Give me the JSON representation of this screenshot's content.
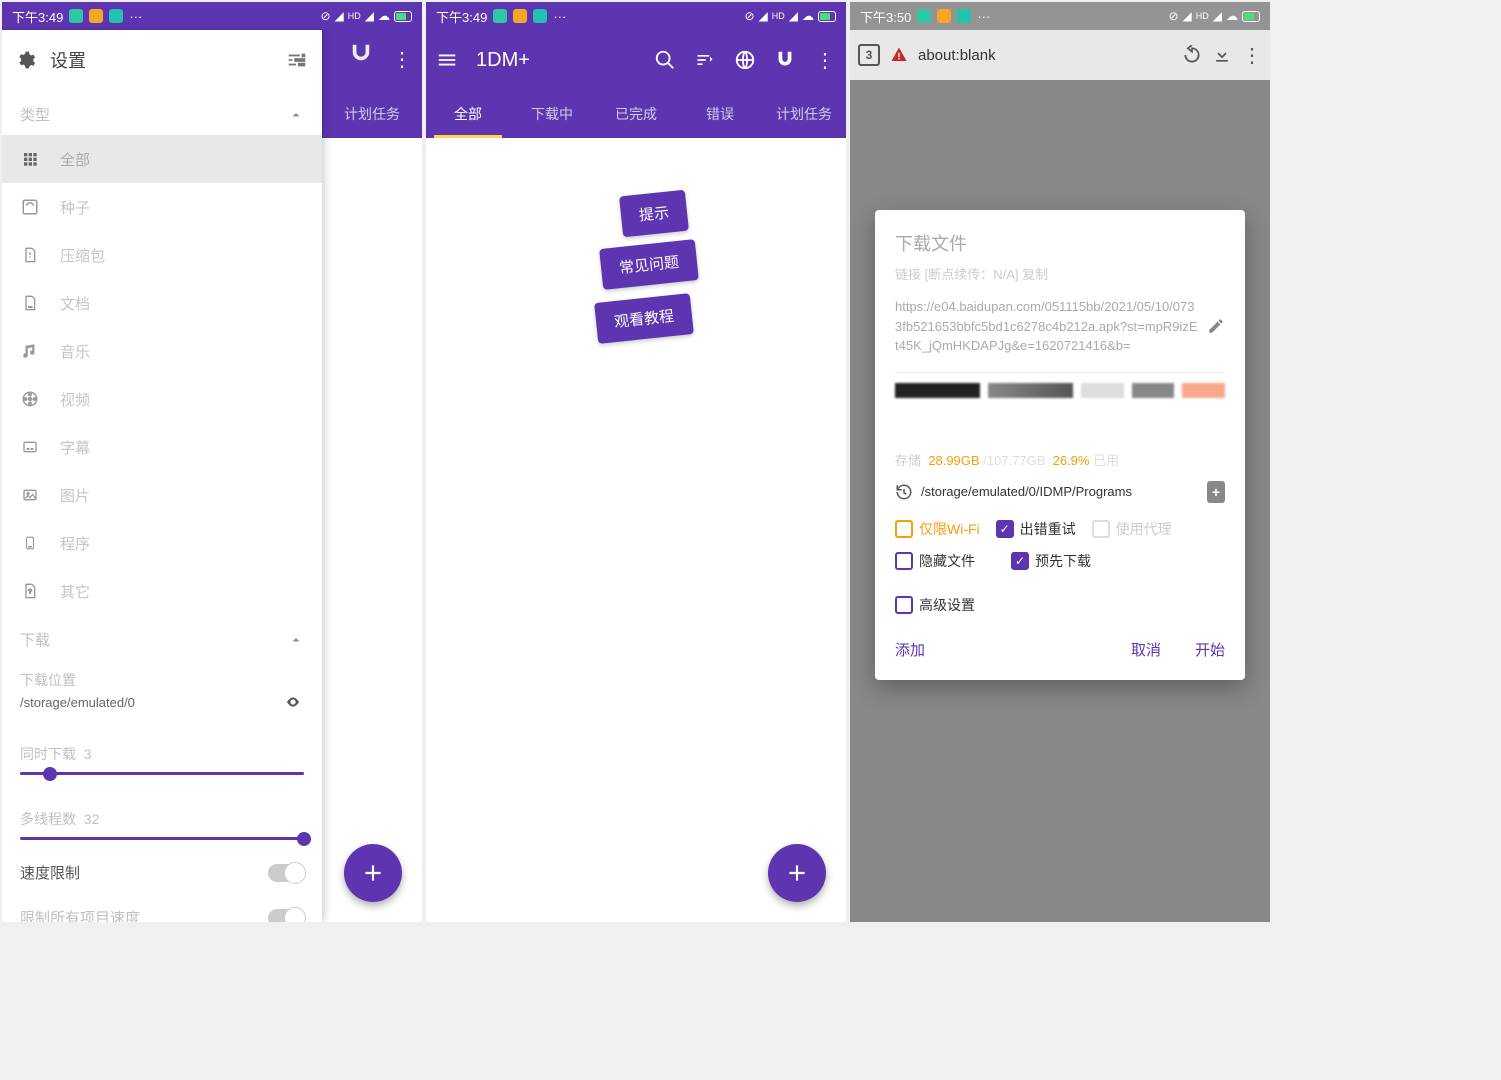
{
  "status": {
    "time1": "下午3:49",
    "time2": "下午3:49",
    "time3": "下午3:50"
  },
  "p1": {
    "settings_label": "设置",
    "section_type": "类型",
    "items": [
      {
        "label": "全部"
      },
      {
        "label": "种子"
      },
      {
        "label": "压缩包"
      },
      {
        "label": "文档"
      },
      {
        "label": "音乐"
      },
      {
        "label": "视频"
      },
      {
        "label": "字幕"
      },
      {
        "label": "图片"
      },
      {
        "label": "程序"
      },
      {
        "label": "其它"
      }
    ],
    "section_dl": "下载",
    "dl_loc_label": "下载位置",
    "dl_path": "/storage/emulated/0",
    "concurrent_label": "同时下载",
    "concurrent_val": "3",
    "threads_label": "多线程数",
    "threads_val": "32",
    "speed_limit": "速度限制",
    "limit_all": "限制所有项目速度",
    "bg_tab": "计划任务"
  },
  "p2": {
    "title": "1DM+",
    "tabs": [
      {
        "label": "全部"
      },
      {
        "label": "下载中"
      },
      {
        "label": "已完成"
      },
      {
        "label": "错误"
      },
      {
        "label": "计划任务"
      }
    ],
    "chips": [
      {
        "label": "提示"
      },
      {
        "label": "常见问题"
      },
      {
        "label": "观看教程"
      }
    ]
  },
  "p3": {
    "tab_count": "3",
    "url_label": "about:blank",
    "dlg": {
      "title": "下载文件",
      "sub": "链接 [断点续传：N/A]   复制",
      "url": "https://e04.baidupan.com/051115bb/2021/05/10/0733fb521653bbfc5bd1c6278c4b212a.apk?st=mpR9izEt45K_jQmHKDAPJg&e=1620721416&b=",
      "storage_label": "存储",
      "storage_free": "28.99GB",
      "storage_total": "107.77GB",
      "storage_pct": "26.9%",
      "storage_used_label": "已用",
      "path": "/storage/emulated/0/IDMP/Programs",
      "check_wifi": "仅限Wi-Fi",
      "check_retry": "出错重试",
      "check_proxy": "使用代理",
      "check_hide": "隐藏文件",
      "check_pre": "预先下载",
      "check_adv": "高级设置",
      "btn_add": "添加",
      "btn_cancel": "取消",
      "btn_start": "开始"
    }
  }
}
